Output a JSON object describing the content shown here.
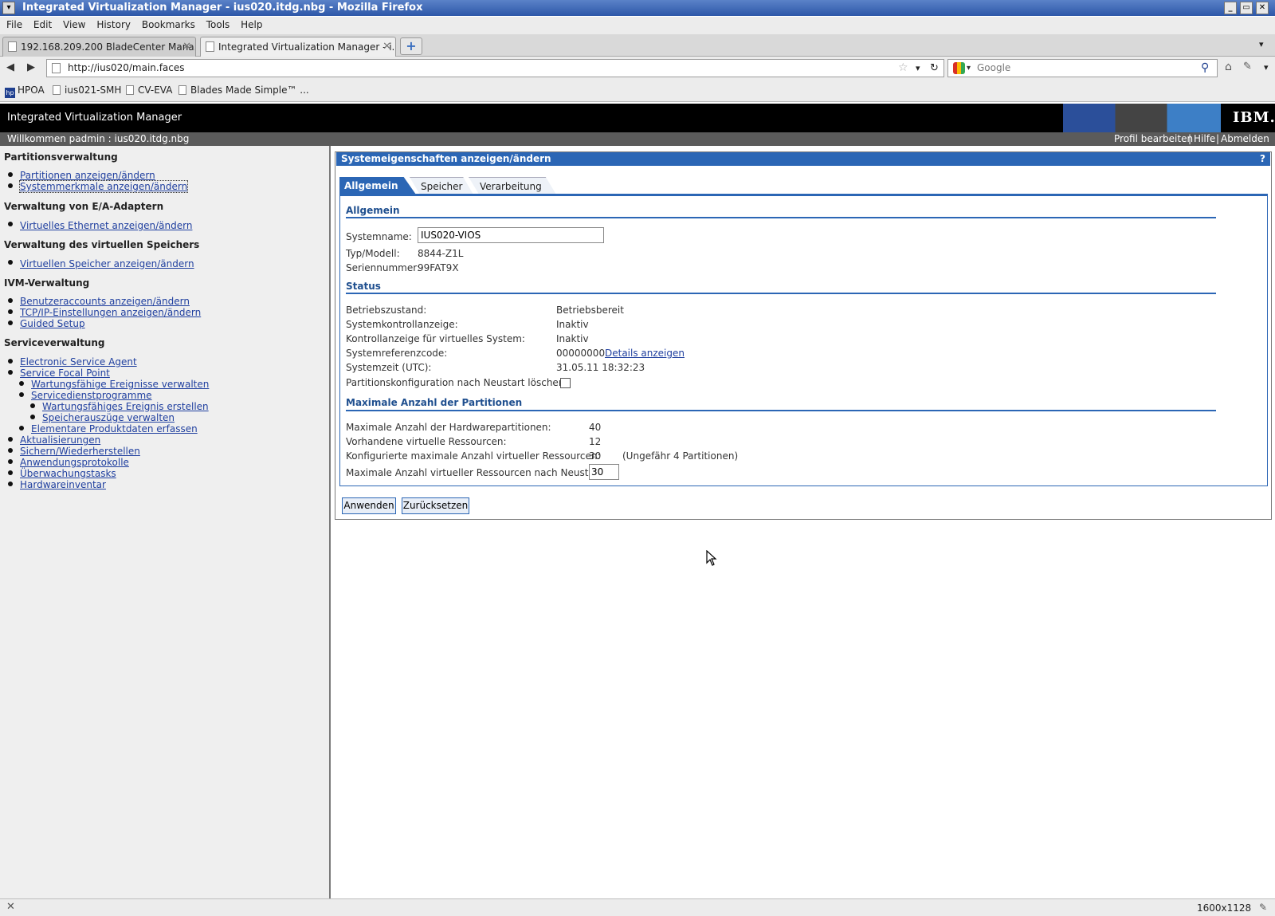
{
  "window": {
    "title": "Integrated Virtualization Manager - ius020.itdg.nbg - Mozilla Firefox"
  },
  "menu": [
    "File",
    "Edit",
    "View",
    "History",
    "Bookmarks",
    "Tools",
    "Help"
  ],
  "tabs": [
    {
      "label": "192.168.209.200 BladeCenter Mana..."
    },
    {
      "label": "Integrated Virtualization Manager - i..."
    }
  ],
  "nav": {
    "url": "http://ius020/main.faces",
    "search_placeholder": "Google"
  },
  "bookmarks": [
    "HPOA",
    "ius021-SMH",
    "CV-EVA",
    "Blades Made Simple™ ..."
  ],
  "ivm": {
    "app_title": "Integrated Virtualization Manager",
    "logo": "IBM.",
    "welcome": "Willkommen padmin : ius020.itdg.nbg",
    "links": [
      "Profil bearbeiten",
      "Hilfe",
      "Abmelden"
    ]
  },
  "sidebar": {
    "sections": [
      {
        "title": "Partitionsverwaltung",
        "items": [
          "Partitionen anzeigen/ändern",
          "Systemmerkmale anzeigen/ändern"
        ]
      },
      {
        "title": "Verwaltung von E/A-Adaptern",
        "items": [
          "Virtuelles Ethernet anzeigen/ändern"
        ]
      },
      {
        "title": "Verwaltung des virtuellen Speichers",
        "items": [
          "Virtuellen Speicher anzeigen/ändern"
        ]
      },
      {
        "title": "IVM-Verwaltung",
        "items": [
          "Benutzeraccounts anzeigen/ändern",
          "TCP/IP-Einstellungen anzeigen/ändern",
          "Guided Setup"
        ]
      },
      {
        "title": "Serviceverwaltung",
        "items": [
          "Electronic Service Agent",
          "Service Focal Point",
          "Wartungsfähige Ereignisse verwalten",
          "Servicedienstprogramme",
          "Wartungsfähiges Ereignis erstellen",
          "Speicherauszüge verwalten",
          "Elementare Produktdaten erfassen",
          "Aktualisierungen",
          "Sichern/Wiederherstellen",
          "Anwendungsprotokolle",
          "Überwachungstasks",
          "Hardwareinventar"
        ]
      }
    ]
  },
  "content": {
    "panel_title": "Systemeigenschaften anzeigen/ändern",
    "help": "?",
    "tabs": [
      "Allgemein",
      "Speicher",
      "Verarbeitung"
    ],
    "general": {
      "heading": "Allgemein",
      "systemname_label": "Systemname:",
      "systemname_value": "IUS020-VIOS",
      "type_label": "Typ/Modell:",
      "type_value": "8844-Z1L",
      "serial_label": "Seriennummer:",
      "serial_value": "99FAT9X"
    },
    "status": {
      "heading": "Status",
      "rows": [
        {
          "label": "Betriebszustand:",
          "value": "Betriebsbereit"
        },
        {
          "label": "Systemkontrollanzeige:",
          "value": "Inaktiv"
        },
        {
          "label": "Kontrollanzeige für virtuelles System:",
          "value": "Inaktiv"
        },
        {
          "label": "Systemreferenzcode:",
          "value": "00000000"
        },
        {
          "label": "Systemzeit (UTC):",
          "value": "31.05.11 18:32:23"
        }
      ],
      "details_link": "Details anzeigen",
      "clear_label": "Partitionskonfiguration nach Neustart löschen:"
    },
    "partitions": {
      "heading": "Maximale Anzahl der Partitionen",
      "rows": [
        {
          "label": "Maximale Anzahl der Hardwarepartitionen:",
          "value": "40"
        },
        {
          "label": "Vorhandene virtuelle Ressourcen:",
          "value": "12"
        },
        {
          "label": "Konfigurierte maximale Anzahl virtueller Ressourcen:",
          "value": "30"
        }
      ],
      "approx": "(Ungefähr 4 Partitionen)",
      "restart_label": "Maximale Anzahl virtueller Ressourcen nach Neustart:",
      "restart_value": "30"
    },
    "buttons": {
      "apply": "Anwenden",
      "reset": "Zurücksetzen"
    }
  },
  "statusbar": {
    "resolution": "1600x1128"
  }
}
